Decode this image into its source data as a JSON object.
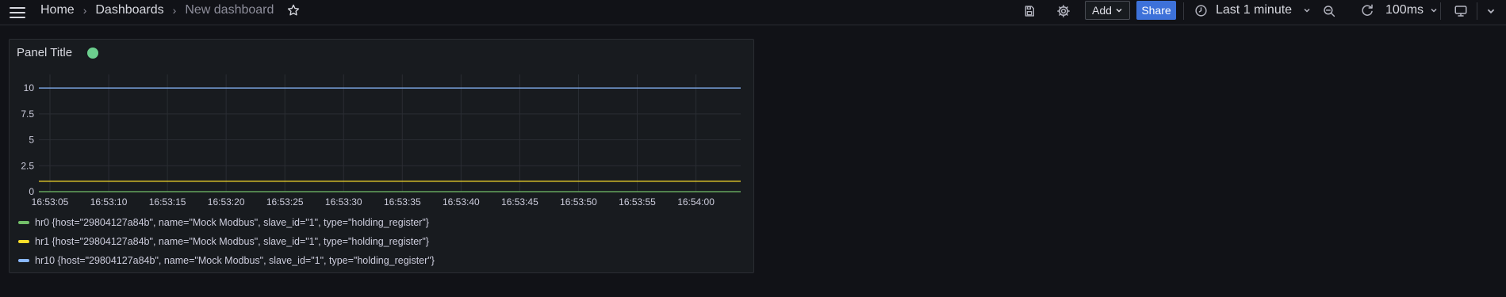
{
  "header": {
    "breadcrumbs": [
      "Home",
      "Dashboards",
      "New dashboard"
    ],
    "add_label": "Add",
    "share_label": "Share",
    "time_range": "Last 1 minute",
    "refresh_interval": "100ms"
  },
  "panel": {
    "title": "Panel Title",
    "status_color": "#6ccf8e"
  },
  "chart_data": {
    "type": "line",
    "x": [
      "16:53:05",
      "16:53:10",
      "16:53:15",
      "16:53:20",
      "16:53:25",
      "16:53:30",
      "16:53:35",
      "16:53:40",
      "16:53:45",
      "16:53:50",
      "16:53:55",
      "16:54:00"
    ],
    "ylim": [
      0,
      11
    ],
    "yticks": [
      {
        "value": 0,
        "label": "0"
      },
      {
        "value": 2.5,
        "label": "2.5"
      },
      {
        "value": 5,
        "label": "5"
      },
      {
        "value": 7.5,
        "label": "7.5"
      },
      {
        "value": 10,
        "label": "10"
      }
    ],
    "grid": true,
    "legend_placement": "bottom",
    "series": [
      {
        "name": "hr0 {host=\"29804127a84b\", name=\"Mock Modbus\", slave_id=\"1\", type=\"holding_register\"}",
        "color": "#73bf69",
        "value": 0
      },
      {
        "name": "hr1 {host=\"29804127a84b\", name=\"Mock Modbus\", slave_id=\"1\", type=\"holding_register\"}",
        "color": "#fade2a",
        "value": 1
      },
      {
        "name": "hr10 {host=\"29804127a84b\", name=\"Mock Modbus\", slave_id=\"1\", type=\"holding_register\"}",
        "color": "#8ab8ff",
        "value": 10
      }
    ]
  }
}
